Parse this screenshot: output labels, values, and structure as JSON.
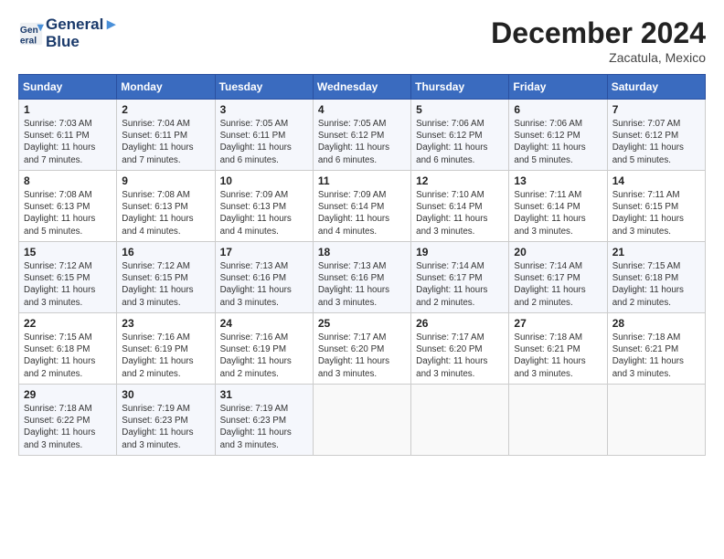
{
  "header": {
    "logo_line1": "General",
    "logo_line2": "Blue",
    "month": "December 2024",
    "location": "Zacatula, Mexico"
  },
  "days_of_week": [
    "Sunday",
    "Monday",
    "Tuesday",
    "Wednesday",
    "Thursday",
    "Friday",
    "Saturday"
  ],
  "weeks": [
    [
      {
        "day": "1",
        "info": "Sunrise: 7:03 AM\nSunset: 6:11 PM\nDaylight: 11 hours\nand 7 minutes."
      },
      {
        "day": "2",
        "info": "Sunrise: 7:04 AM\nSunset: 6:11 PM\nDaylight: 11 hours\nand 7 minutes."
      },
      {
        "day": "3",
        "info": "Sunrise: 7:05 AM\nSunset: 6:11 PM\nDaylight: 11 hours\nand 6 minutes."
      },
      {
        "day": "4",
        "info": "Sunrise: 7:05 AM\nSunset: 6:12 PM\nDaylight: 11 hours\nand 6 minutes."
      },
      {
        "day": "5",
        "info": "Sunrise: 7:06 AM\nSunset: 6:12 PM\nDaylight: 11 hours\nand 6 minutes."
      },
      {
        "day": "6",
        "info": "Sunrise: 7:06 AM\nSunset: 6:12 PM\nDaylight: 11 hours\nand 5 minutes."
      },
      {
        "day": "7",
        "info": "Sunrise: 7:07 AM\nSunset: 6:12 PM\nDaylight: 11 hours\nand 5 minutes."
      }
    ],
    [
      {
        "day": "8",
        "info": "Sunrise: 7:08 AM\nSunset: 6:13 PM\nDaylight: 11 hours\nand 5 minutes."
      },
      {
        "day": "9",
        "info": "Sunrise: 7:08 AM\nSunset: 6:13 PM\nDaylight: 11 hours\nand 4 minutes."
      },
      {
        "day": "10",
        "info": "Sunrise: 7:09 AM\nSunset: 6:13 PM\nDaylight: 11 hours\nand 4 minutes."
      },
      {
        "day": "11",
        "info": "Sunrise: 7:09 AM\nSunset: 6:14 PM\nDaylight: 11 hours\nand 4 minutes."
      },
      {
        "day": "12",
        "info": "Sunrise: 7:10 AM\nSunset: 6:14 PM\nDaylight: 11 hours\nand 3 minutes."
      },
      {
        "day": "13",
        "info": "Sunrise: 7:11 AM\nSunset: 6:14 PM\nDaylight: 11 hours\nand 3 minutes."
      },
      {
        "day": "14",
        "info": "Sunrise: 7:11 AM\nSunset: 6:15 PM\nDaylight: 11 hours\nand 3 minutes."
      }
    ],
    [
      {
        "day": "15",
        "info": "Sunrise: 7:12 AM\nSunset: 6:15 PM\nDaylight: 11 hours\nand 3 minutes."
      },
      {
        "day": "16",
        "info": "Sunrise: 7:12 AM\nSunset: 6:15 PM\nDaylight: 11 hours\nand 3 minutes."
      },
      {
        "day": "17",
        "info": "Sunrise: 7:13 AM\nSunset: 6:16 PM\nDaylight: 11 hours\nand 3 minutes."
      },
      {
        "day": "18",
        "info": "Sunrise: 7:13 AM\nSunset: 6:16 PM\nDaylight: 11 hours\nand 3 minutes."
      },
      {
        "day": "19",
        "info": "Sunrise: 7:14 AM\nSunset: 6:17 PM\nDaylight: 11 hours\nand 2 minutes."
      },
      {
        "day": "20",
        "info": "Sunrise: 7:14 AM\nSunset: 6:17 PM\nDaylight: 11 hours\nand 2 minutes."
      },
      {
        "day": "21",
        "info": "Sunrise: 7:15 AM\nSunset: 6:18 PM\nDaylight: 11 hours\nand 2 minutes."
      }
    ],
    [
      {
        "day": "22",
        "info": "Sunrise: 7:15 AM\nSunset: 6:18 PM\nDaylight: 11 hours\nand 2 minutes."
      },
      {
        "day": "23",
        "info": "Sunrise: 7:16 AM\nSunset: 6:19 PM\nDaylight: 11 hours\nand 2 minutes."
      },
      {
        "day": "24",
        "info": "Sunrise: 7:16 AM\nSunset: 6:19 PM\nDaylight: 11 hours\nand 2 minutes."
      },
      {
        "day": "25",
        "info": "Sunrise: 7:17 AM\nSunset: 6:20 PM\nDaylight: 11 hours\nand 3 minutes."
      },
      {
        "day": "26",
        "info": "Sunrise: 7:17 AM\nSunset: 6:20 PM\nDaylight: 11 hours\nand 3 minutes."
      },
      {
        "day": "27",
        "info": "Sunrise: 7:18 AM\nSunset: 6:21 PM\nDaylight: 11 hours\nand 3 minutes."
      },
      {
        "day": "28",
        "info": "Sunrise: 7:18 AM\nSunset: 6:21 PM\nDaylight: 11 hours\nand 3 minutes."
      }
    ],
    [
      {
        "day": "29",
        "info": "Sunrise: 7:18 AM\nSunset: 6:22 PM\nDaylight: 11 hours\nand 3 minutes."
      },
      {
        "day": "30",
        "info": "Sunrise: 7:19 AM\nSunset: 6:23 PM\nDaylight: 11 hours\nand 3 minutes."
      },
      {
        "day": "31",
        "info": "Sunrise: 7:19 AM\nSunset: 6:23 PM\nDaylight: 11 hours\nand 3 minutes."
      },
      {
        "day": "",
        "info": ""
      },
      {
        "day": "",
        "info": ""
      },
      {
        "day": "",
        "info": ""
      },
      {
        "day": "",
        "info": ""
      }
    ]
  ]
}
